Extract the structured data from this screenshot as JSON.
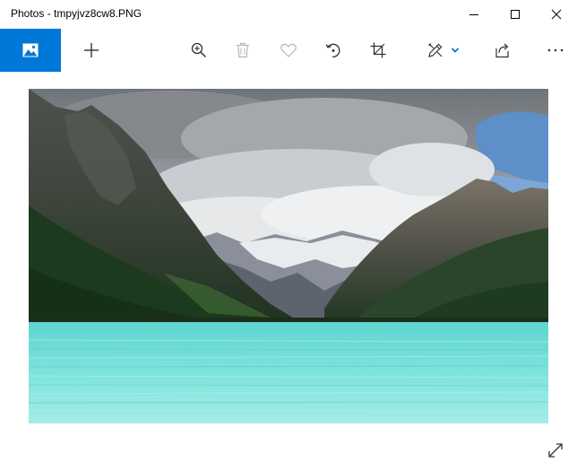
{
  "window": {
    "title": "Photos - tmpyjvz8cw8.PNG",
    "controls": [
      "minimize-icon",
      "maximize-icon",
      "close-icon"
    ]
  },
  "toolbar": {
    "app_icon": "photo-icon",
    "buttons": [
      {
        "icon": "add-icon",
        "enabled": true
      },
      {
        "icon": "zoom-in-icon",
        "enabled": true
      },
      {
        "icon": "trash-icon",
        "enabled": false
      },
      {
        "icon": "heart-icon",
        "enabled": false
      },
      {
        "icon": "rotate-icon",
        "enabled": true
      },
      {
        "icon": "crop-icon",
        "enabled": true
      },
      {
        "icon": "edit-draw-icon",
        "enabled": true
      },
      {
        "icon": "chevron-down-icon",
        "enabled": true
      },
      {
        "icon": "share-icon",
        "enabled": true
      },
      {
        "icon": "more-icon",
        "enabled": true
      }
    ]
  },
  "viewer": {
    "image": "mountain-lake-photo",
    "expand_icon": "expand-icon"
  },
  "colors": {
    "accent": "#0078d7",
    "icon": "#333333",
    "icon_disabled": "#b5b5b5"
  }
}
